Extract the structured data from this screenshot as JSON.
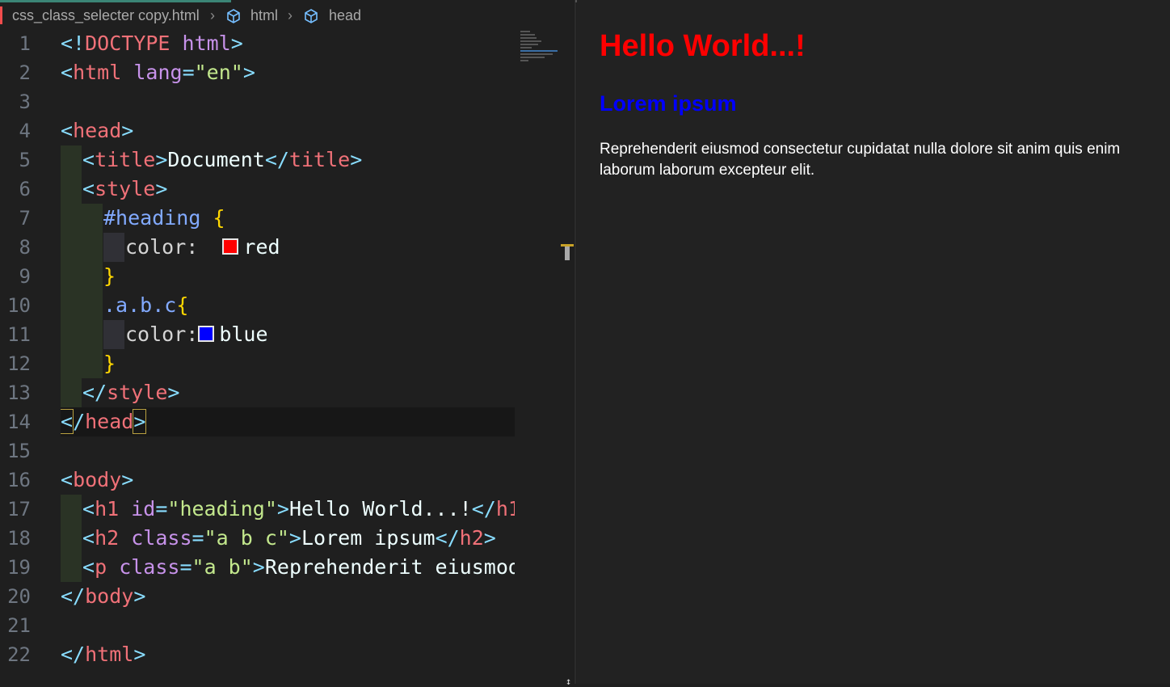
{
  "breadcrumb": {
    "file": "css_class_selecter copy.html",
    "items": [
      "html",
      "head"
    ],
    "icon": "cube-icon"
  },
  "editor": {
    "line_numbers": [
      "1",
      "2",
      "3",
      "4",
      "5",
      "6",
      "7",
      "8",
      "9",
      "10",
      "11",
      "12",
      "13",
      "14",
      "15",
      "16",
      "17",
      "18",
      "19",
      "20",
      "21",
      "22"
    ],
    "lines": {
      "l1": {
        "open": "<!",
        "kw": "DOCTYPE",
        "sp": " ",
        "val": "html",
        "close": ">"
      },
      "l2": {
        "open": "<",
        "tag": "html",
        "sp": " ",
        "attr": "lang",
        "eq": "=",
        "str": "\"en\"",
        "close": ">"
      },
      "l4": {
        "open": "<",
        "tag": "head",
        "close": ">"
      },
      "l5": {
        "open": "<",
        "tag": "title",
        "close": ">",
        "text": "Document",
        "open2": "</",
        "tag2": "title",
        "close2": ">"
      },
      "l6": {
        "open": "<",
        "tag": "style",
        "close": ">"
      },
      "l7": {
        "sel": "#heading",
        "sp": " ",
        "brace": "{"
      },
      "l8": {
        "prop": "color:",
        "sp": "  ",
        "val": "red",
        "swatch_color": "#ff0000"
      },
      "l9": {
        "brace": "}"
      },
      "l10": {
        "sel": ".a.b.c",
        "brace": "{"
      },
      "l11": {
        "prop": "color:",
        "val": "blue",
        "swatch_color": "#0000ff"
      },
      "l12": {
        "brace": "}"
      },
      "l13": {
        "open": "</",
        "tag": "style",
        "close": ">"
      },
      "l14": {
        "open": "<",
        "slash": "/",
        "tag": "head",
        "close": ">"
      },
      "l16": {
        "open": "<",
        "tag": "body",
        "close": ">"
      },
      "l17": {
        "open": "<",
        "tag": "h1",
        "sp": " ",
        "attr": "id",
        "eq": "=",
        "str": "\"heading\"",
        "close": ">",
        "text": "Hello World...!",
        "open2": "</",
        "tag2": "h1",
        "close2": ">"
      },
      "l18": {
        "open": "<",
        "tag": "h2",
        "sp": " ",
        "attr": "class",
        "eq": "=",
        "str": "\"a b c\"",
        "close": ">",
        "text": "Lorem ipsum",
        "open2": "</",
        "tag2": "h2",
        "close2": ">"
      },
      "l19": {
        "open": "<",
        "tag": "p",
        "sp": " ",
        "attr": "class",
        "eq": "=",
        "str": "\"a b\"",
        "close": ">",
        "text": "Reprehenderit eiusmod cor"
      },
      "l20": {
        "open": "</",
        "tag": "body",
        "close": ">"
      },
      "l22": {
        "open": "</",
        "tag": "html",
        "close": ">"
      }
    }
  },
  "preview": {
    "h1": "Hello World...!",
    "h2": "Lorem ipsum",
    "p": "Reprehenderit eiusmod consectetur cupidatat nulla dolore sit anim quis enim laborum laborum excepteur elit.",
    "h1_color": "#ff0000",
    "h2_color": "#0000ff"
  }
}
